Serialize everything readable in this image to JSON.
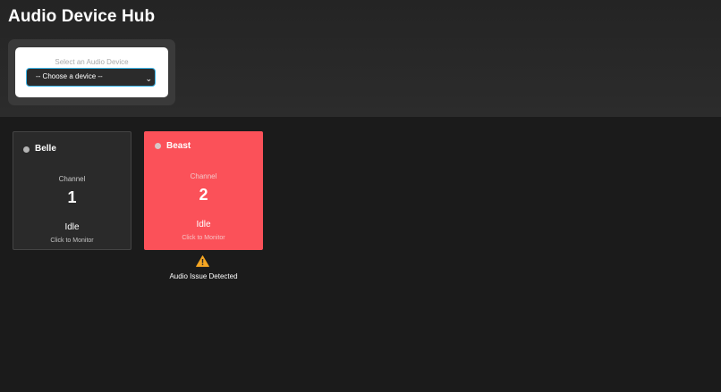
{
  "app": {
    "title": "Audio Device Hub"
  },
  "selector": {
    "label": "Select an Audio Device",
    "selected_value": "-- Choose a device --",
    "accent_color": "#3db6e8"
  },
  "devices": [
    {
      "name": "Belle",
      "channel_label": "Channel",
      "channel": "1",
      "status": "Idle",
      "hint": "Click to Monitor",
      "state": "ok"
    },
    {
      "name": "Beast",
      "channel_label": "Channel",
      "channel": "2",
      "status": "Idle",
      "hint": "Click to Monitor",
      "state": "alert",
      "alert_color": "#fb5159"
    }
  ],
  "warning": {
    "icon": "warning-triangle-icon",
    "text": "Audio Issue Detected",
    "color": "#f5a623"
  }
}
